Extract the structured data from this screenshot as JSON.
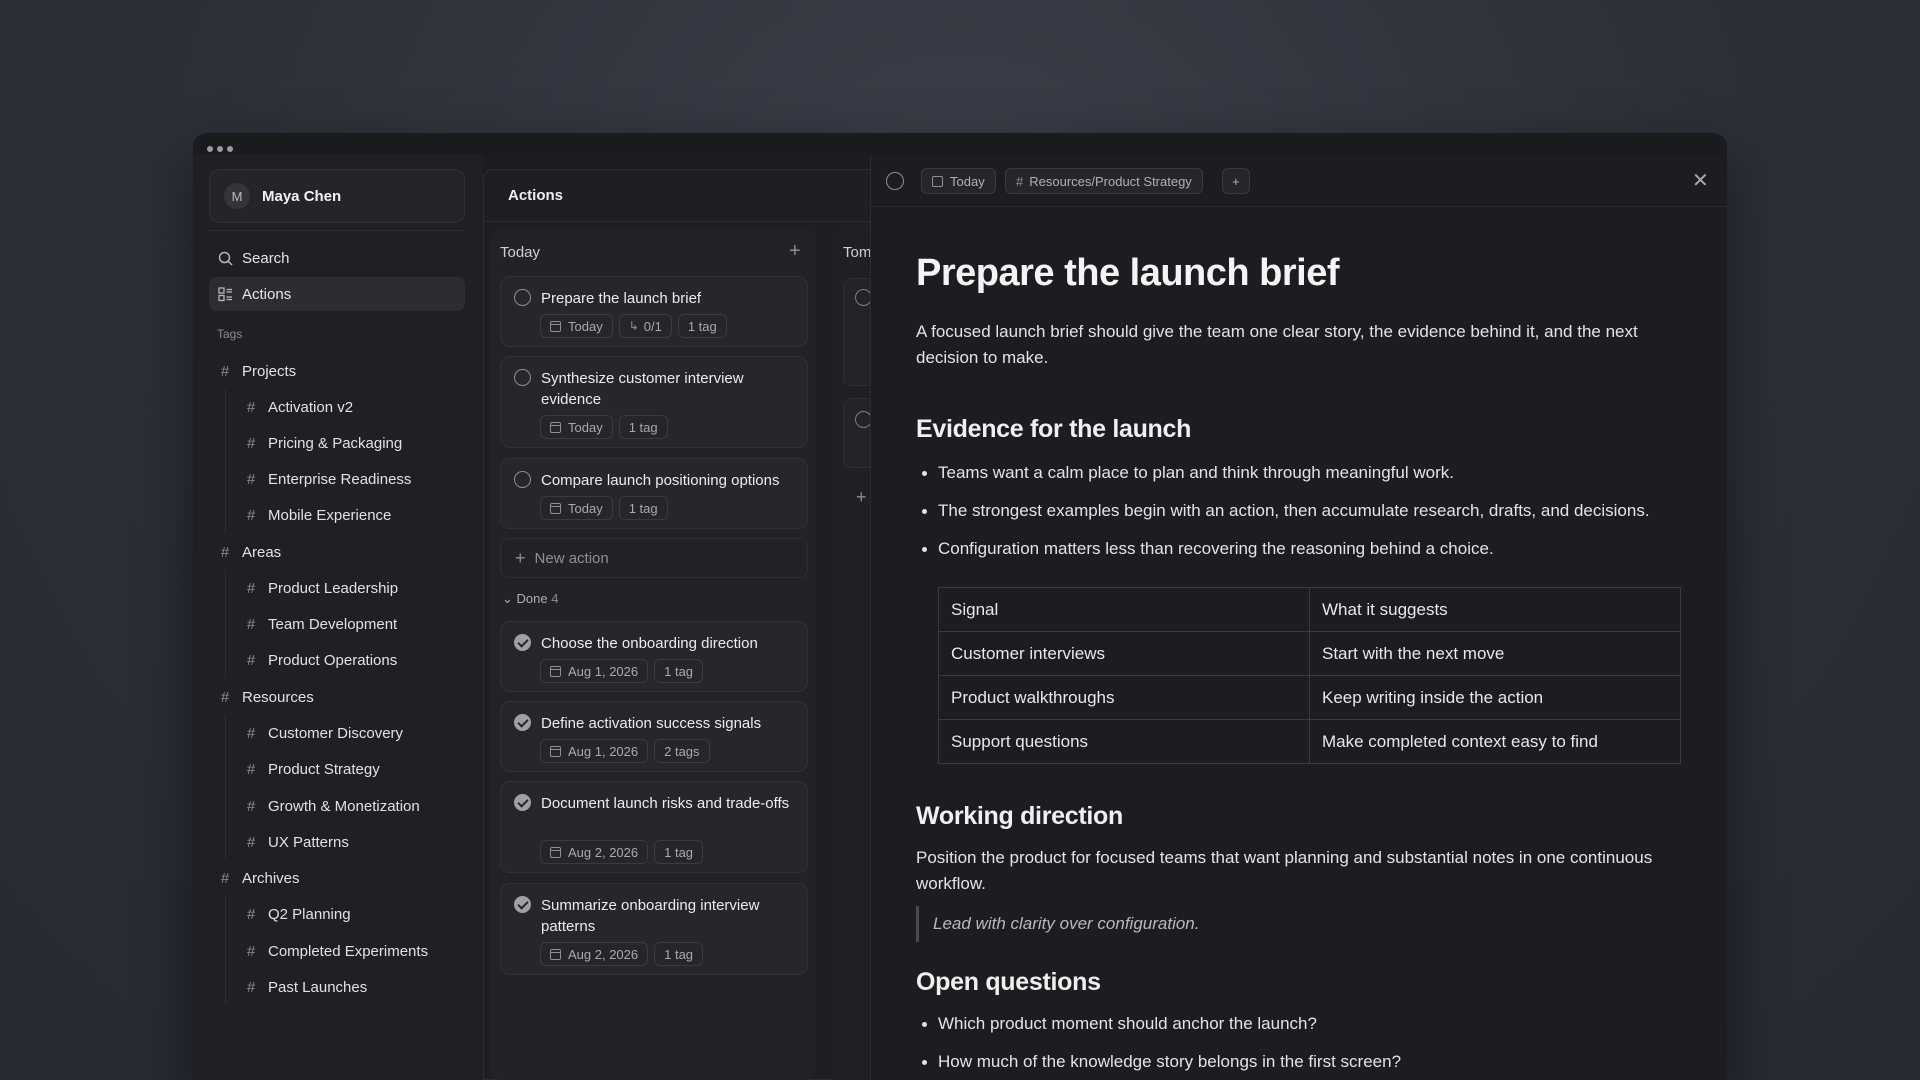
{
  "user": {
    "initial": "M",
    "name": "Maya Chen"
  },
  "nav": {
    "search": "Search",
    "actions": "Actions"
  },
  "tags_label": "Tags",
  "tags": {
    "projects": {
      "label": "Projects",
      "items": [
        "Activation v2",
        "Pricing & Packaging",
        "Enterprise Readiness",
        "Mobile Experience"
      ]
    },
    "areas": {
      "label": "Areas",
      "items": [
        "Product Leadership",
        "Team Development",
        "Product Operations"
      ]
    },
    "resources": {
      "label": "Resources",
      "items": [
        "Customer Discovery",
        "Product Strategy",
        "Growth & Monetization",
        "UX Patterns"
      ]
    },
    "archives": {
      "label": "Archives",
      "items": [
        "Q2 Planning",
        "Completed Experiments",
        "Past Launches"
      ]
    }
  },
  "actions_panel": {
    "title": "Actions",
    "today": {
      "title": "Today",
      "cards": [
        {
          "title": "Prepare the launch brief",
          "chips": [
            "Today",
            "0/1",
            "1 tag"
          ]
        },
        {
          "title": "Synthesize customer interview evidence",
          "chips": [
            "Today",
            "1 tag"
          ]
        },
        {
          "title": "Compare launch positioning options",
          "chips": [
            "Today",
            "1 tag"
          ]
        }
      ],
      "new_action": "New action",
      "done_label": "Done",
      "done_count": "4",
      "done_cards": [
        {
          "title": "Choose the onboarding direction",
          "chips": [
            "Aug 1, 2026",
            "1 tag"
          ]
        },
        {
          "title": "Define activation success signals",
          "chips": [
            "Aug 1, 2026",
            "2 tags"
          ]
        },
        {
          "title": "Document launch risks and trade-offs",
          "chips": [
            "Aug 2, 2026",
            "1 tag"
          ]
        },
        {
          "title": "Summarize onboarding interview patterns",
          "chips": [
            "Aug 2, 2026",
            "1 tag"
          ]
        }
      ]
    },
    "tomorrow_title": "Tom"
  },
  "detail": {
    "chip_date": "Today",
    "chip_tag": "Resources/Product Strategy",
    "title": "Prepare the launch brief",
    "intro": "A focused launch brief should give the team one clear story, the evidence behind it, and the next decision to make.",
    "evidence_heading": "Evidence for the launch",
    "evidence_bullets": [
      "Teams want a calm place to plan and think through meaningful work.",
      "The strongest examples begin with an action, then accumulate research, drafts, and decisions.",
      "Configuration matters less than recovering the reasoning behind a choice."
    ],
    "table": [
      [
        "Signal",
        "What it suggests"
      ],
      [
        "Customer interviews",
        "Start with the next move"
      ],
      [
        "Product walkthroughs",
        "Keep writing inside the action"
      ],
      [
        "Support questions",
        "Make completed context easy to find"
      ]
    ],
    "direction_heading": "Working direction",
    "direction_text": "Position the product for focused teams that want planning and substantial notes in one continuous workflow.",
    "quote": "Lead with clarity over configuration.",
    "questions_heading": "Open questions",
    "questions": [
      "Which product moment should anchor the launch?",
      "How much of the knowledge story belongs in the first screen?"
    ]
  }
}
